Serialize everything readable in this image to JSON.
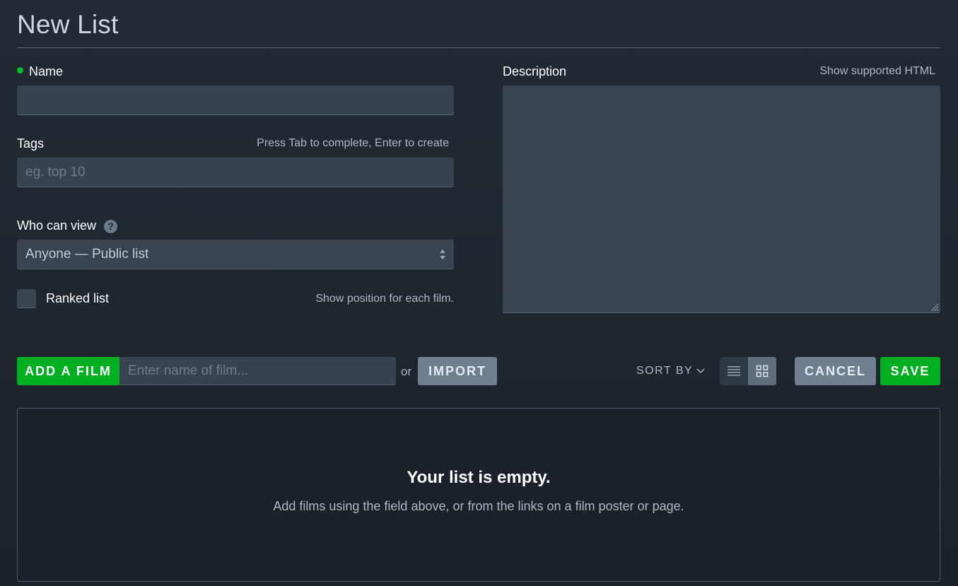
{
  "page": {
    "title": "New List"
  },
  "form": {
    "name_label": "Name",
    "name_value": "",
    "description_label": "Description",
    "description_hint": "Show supported HTML",
    "tags_label": "Tags",
    "tags_hint": "Press Tab to complete, Enter to create",
    "tags_placeholder": "eg. top 10",
    "visibility_label": "Who can view",
    "visibility_help_glyph": "?",
    "visibility_selected": "Anyone — Public list",
    "ranked_label": "Ranked list",
    "ranked_hint": "Show position for each film.",
    "ranked_checked": false
  },
  "toolbar": {
    "add_film_label": "Add a film",
    "film_placeholder": "Enter name of film...",
    "or_text": "or",
    "import_label": "Import",
    "sort_label": "SORT BY",
    "cancel_label": "Cancel",
    "save_label": "Save"
  },
  "empty_state": {
    "title": "Your list is empty.",
    "text": "Add films using the field above, or from the links on a film poster or page."
  },
  "colors": {
    "accent_green": "#00b020",
    "required_dot": "#00c030",
    "button_grey": "#6f7f8f",
    "field_bg": "#39434f"
  },
  "icons": {
    "help": "question-circle-icon",
    "select": "select-arrows-icon",
    "sort": "chevron-down-icon",
    "list_view": "list-view-icon",
    "grid_view": "grid-view-icon",
    "resize": "resize-grip-icon"
  }
}
